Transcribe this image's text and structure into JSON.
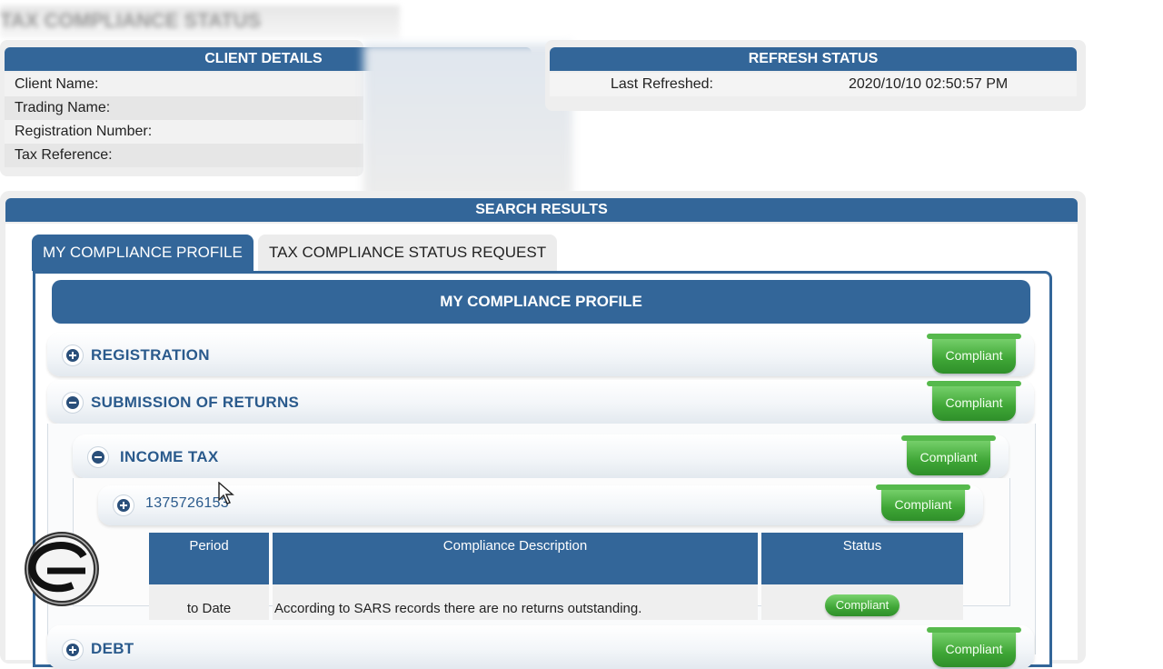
{
  "page": {
    "title": "TAX COMPLIANCE STATUS"
  },
  "client_details": {
    "header": "CLIENT DETAILS",
    "fields": [
      {
        "label": "Client Name:",
        "value": ""
      },
      {
        "label": "Trading Name:",
        "value": ""
      },
      {
        "label": "Registration Number:",
        "value": ""
      },
      {
        "label": "Tax Reference:",
        "value": ""
      }
    ]
  },
  "refresh_status": {
    "header": "REFRESH STATUS",
    "label": "Last Refreshed:",
    "value": "2020/10/10 02:50:57 PM"
  },
  "search_results": {
    "header": "SEARCH RESULTS",
    "tabs": [
      {
        "label": "MY COMPLIANCE PROFILE",
        "active": true
      },
      {
        "label": "TAX COMPLIANCE STATUS REQUEST",
        "active": false
      }
    ],
    "profile_title": "MY COMPLIANCE PROFILE",
    "sections": [
      {
        "label": "REGISTRATION",
        "expanded": false,
        "status": "Compliant"
      },
      {
        "label": "SUBMISSION OF RETURNS",
        "expanded": true,
        "status": "Compliant"
      },
      {
        "label": "INCOME TAX",
        "expanded": true,
        "status": "Compliant"
      },
      {
        "label": "1375726153",
        "expanded": false,
        "status": "Compliant"
      },
      {
        "label": "DEBT",
        "expanded": false,
        "status": "Compliant"
      }
    ],
    "table": {
      "headers": [
        "Period",
        "Compliance Description",
        "Status"
      ],
      "rows": [
        {
          "period": "to Date",
          "description": "According to SARS records there are no returns outstanding.",
          "status": "Compliant"
        }
      ]
    }
  },
  "colors": {
    "brand_blue": "#336699",
    "compliant_green": "#3fa636"
  }
}
